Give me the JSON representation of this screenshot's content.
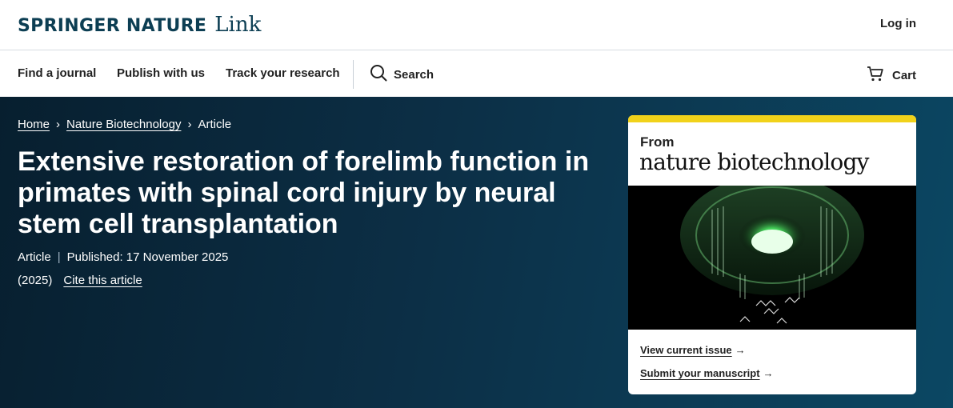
{
  "header": {
    "brand_main": "SPRINGER NATURE",
    "brand_link": "Link",
    "login_label": "Log in"
  },
  "nav": {
    "items": [
      "Find a journal",
      "Publish with us",
      "Track your research"
    ],
    "search_label": "Search",
    "cart_label": "Cart"
  },
  "breadcrumb": {
    "items": [
      "Home",
      "Nature Biotechnology",
      "Article"
    ]
  },
  "article": {
    "title": "Extensive restoration of forelimb function in primates with spinal cord injury by neural stem cell transplantation",
    "type": "Article",
    "published": "Published: 17 November 2025",
    "year": "(2025)",
    "cite_label": "Cite this article"
  },
  "journal_card": {
    "from_label": "From",
    "journal_name": "nature biotechnology",
    "accent_color": "#f1d21a",
    "links": [
      "View current issue",
      "Submit your manuscript"
    ]
  },
  "colors": {
    "brand": "#0c3e53",
    "hero_dark": "#071f2f",
    "hero_light": "#0b4763"
  }
}
